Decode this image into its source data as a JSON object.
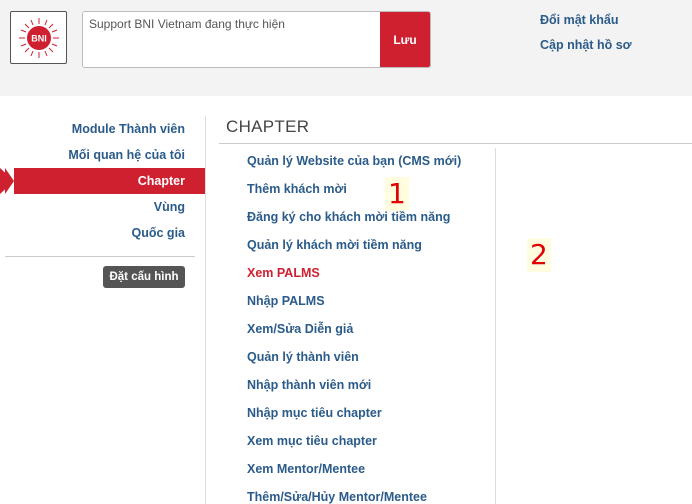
{
  "header": {
    "logo_text": "BNI",
    "status_placeholder": "Support BNI Vietnam đang thực hiện",
    "save_label": "Lưu",
    "links": [
      "Đổi mật khẩu",
      "Cập nhật hồ sơ"
    ]
  },
  "sidebar": {
    "items": [
      {
        "label": "Module Thành viên"
      },
      {
        "label": "Mối quan hệ của tôi"
      },
      {
        "label": "Chapter"
      },
      {
        "label": "Vùng"
      },
      {
        "label": "Quốc gia"
      }
    ],
    "active_index": 2,
    "config_button": "Đặt cấu hình"
  },
  "main": {
    "title": "CHAPTER",
    "menu": [
      {
        "label": "Quản lý Website của bạn (CMS mới)"
      },
      {
        "label": "Thêm khách mời"
      },
      {
        "label": "Đăng ký cho khách mời tiềm năng"
      },
      {
        "label": "Quản lý khách mời tiềm năng"
      },
      {
        "label": "Xem PALMS"
      },
      {
        "label": "Nhập PALMS"
      },
      {
        "label": "Xem/Sửa Diễn giả"
      },
      {
        "label": "Quản lý thành viên"
      },
      {
        "label": "Nhập thành viên mới"
      },
      {
        "label": "Nhập mục tiêu chapter"
      },
      {
        "label": "Xem mục tiêu chapter"
      },
      {
        "label": "Xem Mentor/Mentee"
      },
      {
        "label": "Thêm/Sửa/Hủy Mentor/Mentee"
      }
    ],
    "active_menu_index": 4
  },
  "annotations": [
    "1",
    "2"
  ],
  "colors": {
    "accent": "#cf2030",
    "link": "#2a5b8a",
    "header_bg": "#f3f3f3"
  }
}
